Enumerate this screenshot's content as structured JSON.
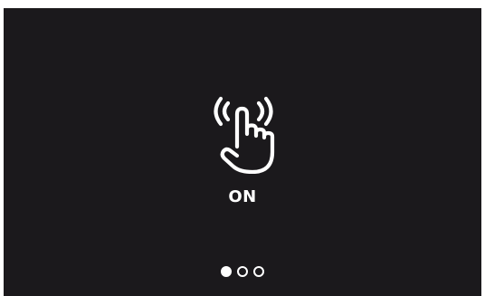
{
  "screen": {
    "background": "#1b191c",
    "icon": "touch-tap-icon",
    "state_label": "ON"
  },
  "pager": {
    "pages": 3,
    "active_index": 0
  }
}
